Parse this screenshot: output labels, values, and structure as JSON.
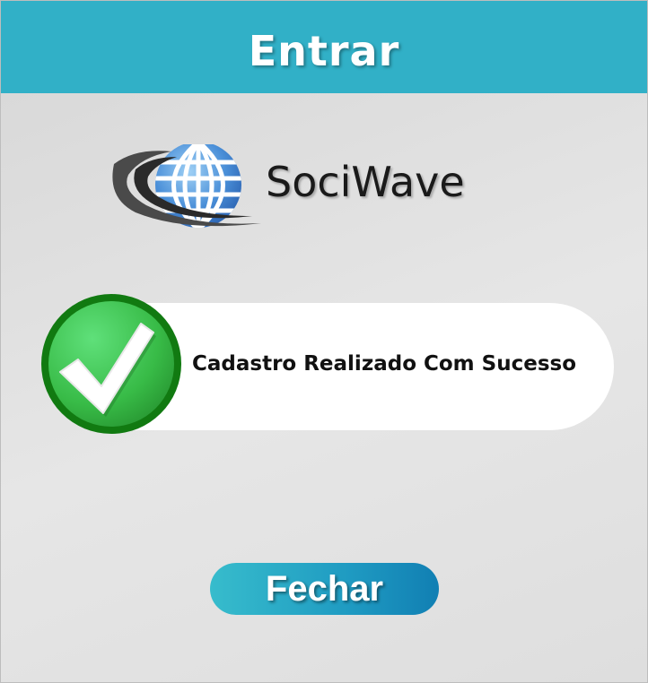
{
  "header": {
    "title": "Entrar"
  },
  "brand": {
    "name": "SociWave",
    "logo_icon": "globe-swoosh-icon"
  },
  "message": {
    "text": "Cadastro Realizado Com Sucesso",
    "icon": "checkmark-icon",
    "status_color": "#1f8f1f"
  },
  "actions": {
    "close_label": "Fechar"
  },
  "colors": {
    "header": "#31b0c7",
    "button_start": "#37bccc",
    "button_end": "#117fb3",
    "success": "#3cc14d"
  }
}
